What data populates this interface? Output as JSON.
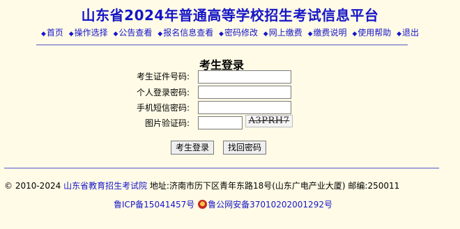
{
  "header": {
    "title": "山东省2024年普通高等学校招生考试信息平台"
  },
  "nav": {
    "bullet": "◆",
    "items": [
      "首页",
      "操作选择",
      "公告查看",
      "报名信息查看",
      "密码修改",
      "网上缴费",
      "缴费说明",
      "使用帮助",
      "退出"
    ]
  },
  "login": {
    "title": "考生登录",
    "id_label": "考生证件号码:",
    "password_label": "个人登录密码:",
    "sms_label": "手机短信密码:",
    "captcha_label": "图片验证码:",
    "captcha_text": "A3PRH7",
    "id_value": "",
    "password_value": "",
    "sms_value": "",
    "captcha_value": "",
    "login_button": "考生登录",
    "retrieve_button": "找回密码"
  },
  "footer": {
    "copyright": "© 2010-2024",
    "org_link": "山东省教育招生考试院",
    "address": "地址:济南市历下区青年东路18号(山东广电产业大厦) 邮编:250011",
    "icp": "鲁ICP备15041457号",
    "police": "鲁公网安备37010202001292号"
  },
  "colors": {
    "link": "#1515c8",
    "background": "#fffbe6",
    "rule": "#5555cc"
  }
}
